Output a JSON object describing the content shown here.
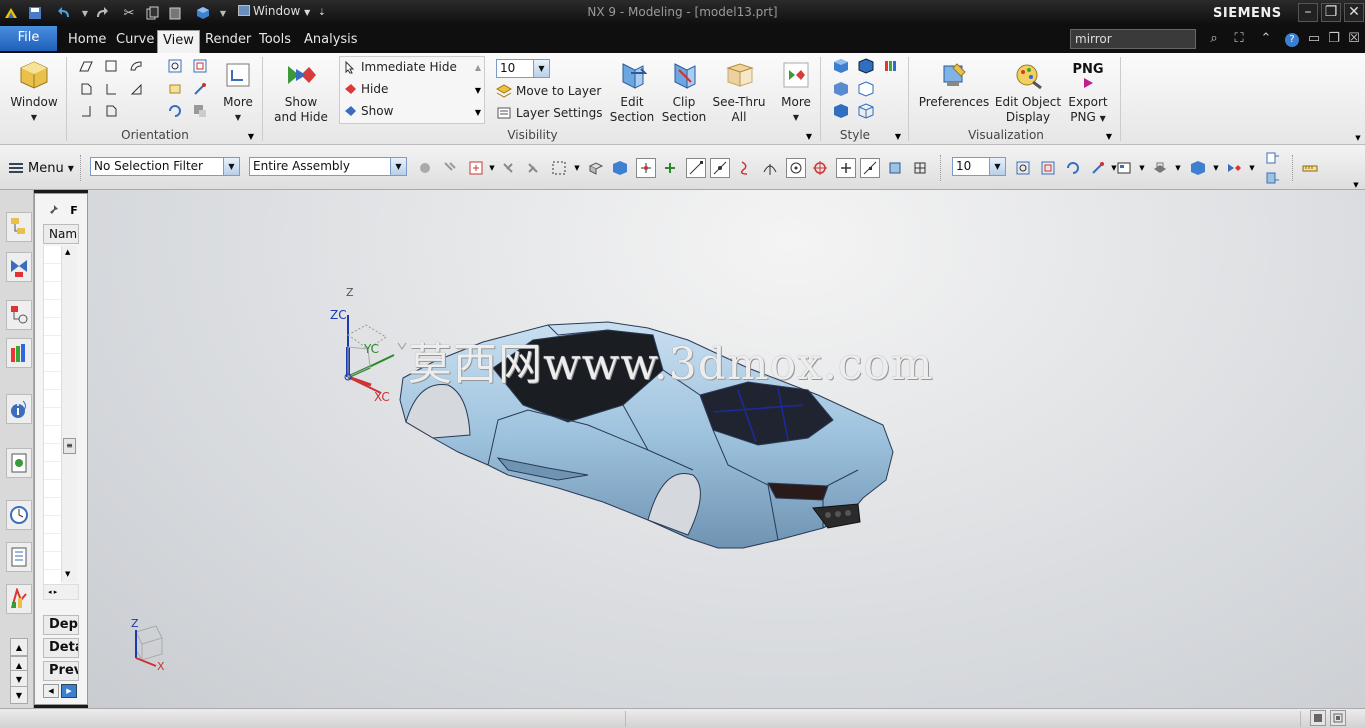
{
  "window": {
    "title": "NX 9 - Modeling - [model13.prt]",
    "brand": "SIEMENS",
    "window_menu": "Window"
  },
  "tabs": {
    "file": "File",
    "items": [
      "Home",
      "Curve",
      "View",
      "Render",
      "Tools",
      "Analysis"
    ],
    "active": "View"
  },
  "search": {
    "value": "mirror"
  },
  "ribbon": {
    "window_button": "Window",
    "orientation": {
      "more": "More",
      "label": "Orientation"
    },
    "visibility": {
      "show_and_hide_line1": "Show",
      "show_and_hide_line2": "and Hide",
      "immediate_hide": "Immediate Hide",
      "hide": "Hide",
      "show": "Show",
      "layer_value": "10",
      "move_to_layer": "Move to Layer",
      "layer_settings": "Layer Settings",
      "edit_section_line1": "Edit",
      "edit_section_line2": "Section",
      "clip_section_line1": "Clip",
      "clip_section_line2": "Section",
      "see_thru_line1": "See-Thru",
      "see_thru_line2": "All",
      "more": "More",
      "label": "Visibility"
    },
    "style": {
      "label": "Style"
    },
    "visualization": {
      "preferences": "Preferences",
      "edit_object_display_line1": "Edit Object",
      "edit_object_display_line2": "Display",
      "export_png_icon": "PNG",
      "export_png_line1": "Export",
      "export_png_line2": "PNG",
      "label": "Visualization"
    }
  },
  "toolbar": {
    "menu": "Menu",
    "selection_filter": "No Selection Filter",
    "assembly_scope": "Entire Assembly",
    "layer_value": "10"
  },
  "navigator": {
    "column_name": "Nam",
    "sections": [
      "Depe",
      "Deta",
      "Previ"
    ]
  },
  "viewport": {
    "watermark": "莫西网www.3dmox.com",
    "triad": {
      "z": "Z",
      "zc": "ZC",
      "yc": "YC",
      "xc": "XC"
    },
    "mini_triad": {
      "z": "Z",
      "x": "X"
    }
  },
  "colors": {
    "file_tab": "#2a6fc9",
    "car_body": "#9ec3de",
    "viewport_bg": "#d5d8dc"
  }
}
